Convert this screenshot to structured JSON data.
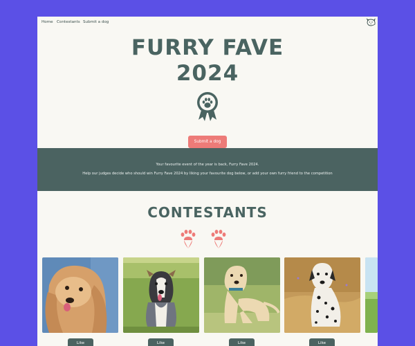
{
  "nav": {
    "links": [
      "Home",
      "Contestants",
      "Submit a dog"
    ]
  },
  "hero": {
    "title_line1": "FURRY FAVE",
    "title_line2": "2024",
    "submit_label": "Submit a dog"
  },
  "intro": {
    "line1": "Your favourite event of the year is back, Furry Fave 2024.",
    "line2": "Help our judges decide who should win Furry Fave 2024 by liking your favourite dog below, or add your own furry friend to the competition"
  },
  "contestants": {
    "heading": "CONTESTANTS",
    "cards": [
      {
        "photo": "cocker-spaniel-photo",
        "like_label": "Like"
      },
      {
        "photo": "australian-shepherd-photo",
        "like_label": "Like"
      },
      {
        "photo": "labrador-photo",
        "like_label": "Like"
      },
      {
        "photo": "dalmatian-photo",
        "like_label": "Like"
      },
      {
        "photo": "partial-photo"
      }
    ]
  },
  "colors": {
    "page_bg": "#5b50e6",
    "card_bg": "#f9f8f3",
    "teal": "#4b6361",
    "coral": "#ed7b78"
  },
  "icons": [
    "logo-icon",
    "award-ribbon-icon",
    "paw-icon"
  ]
}
